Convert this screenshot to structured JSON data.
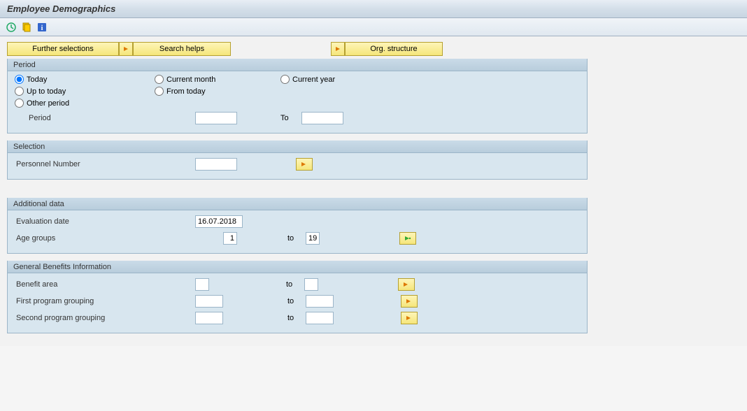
{
  "title": "Employee Demographics",
  "buttons": {
    "further_selections": "Further selections",
    "search_helps": "Search helps",
    "org_structure": "Org. structure"
  },
  "period": {
    "title": "Period",
    "radios": {
      "today": "Today",
      "current_month": "Current month",
      "current_year": "Current year",
      "up_to_today": "Up to today",
      "from_today": "From today",
      "other_period": "Other period"
    },
    "selected": "today",
    "period_label": "Period",
    "to_label": "To",
    "from_value": "",
    "to_value": ""
  },
  "selection": {
    "title": "Selection",
    "personnel_number_label": "Personnel Number",
    "personnel_number_value": ""
  },
  "additional": {
    "title": "Additional data",
    "evaluation_date_label": "Evaluation date",
    "evaluation_date_value": "16.07.2018",
    "age_groups_label": "Age groups",
    "age_groups_from": "1",
    "to_label": "to",
    "age_groups_to": "19"
  },
  "benefits": {
    "title": "General Benefits Information",
    "to_label": "to",
    "rows": [
      {
        "label": "Benefit area",
        "from": "",
        "to": ""
      },
      {
        "label": "First program grouping",
        "from": "",
        "to": ""
      },
      {
        "label": "Second program grouping",
        "from": "",
        "to": ""
      }
    ]
  }
}
